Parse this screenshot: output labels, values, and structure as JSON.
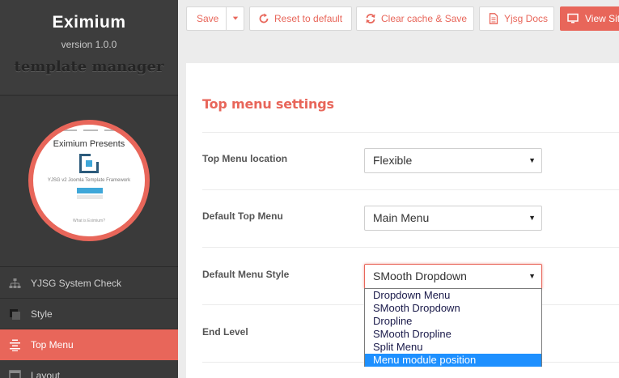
{
  "sidebar": {
    "brand_name": "Eximium",
    "version": "version 1.0.0",
    "subtitle": "template manager",
    "preview": {
      "title": "Eximium Presents",
      "tagline": "YJSG v2 Joomla Template Framework",
      "footer": "What is Eximium?"
    },
    "menu": [
      {
        "label": "YJSG System Check",
        "icon": "sitemap-icon"
      },
      {
        "label": "Style",
        "icon": "style-icon"
      },
      {
        "label": "Top Menu",
        "icon": "list-icon",
        "active": true
      },
      {
        "label": "Layout",
        "icon": "layout-icon"
      }
    ]
  },
  "toolbar": {
    "save": "Save",
    "reset": "Reset to default",
    "clear_cache": "Clear cache & Save",
    "docs": "Yjsg Docs",
    "view_site": "View Site"
  },
  "main": {
    "section_title": "Top menu settings",
    "fields": [
      {
        "label": "Top Menu location",
        "value": "Flexible"
      },
      {
        "label": "Default Top Menu",
        "value": "Main Menu"
      },
      {
        "label": "Default Menu Style",
        "value": "SMooth Dropdown"
      },
      {
        "label": "End Level",
        "value": ""
      }
    ],
    "menu_style_options": [
      "Dropdown Menu",
      "SMooth Dropdown",
      "Dropline",
      "SMooth Dropline",
      "Split Menu",
      "Menu module position"
    ],
    "highlighted_option": "Menu module position"
  },
  "colors": {
    "accent": "#e8665a",
    "sidebar_bg": "#3a3a3a",
    "highlight": "#1e90ff"
  }
}
